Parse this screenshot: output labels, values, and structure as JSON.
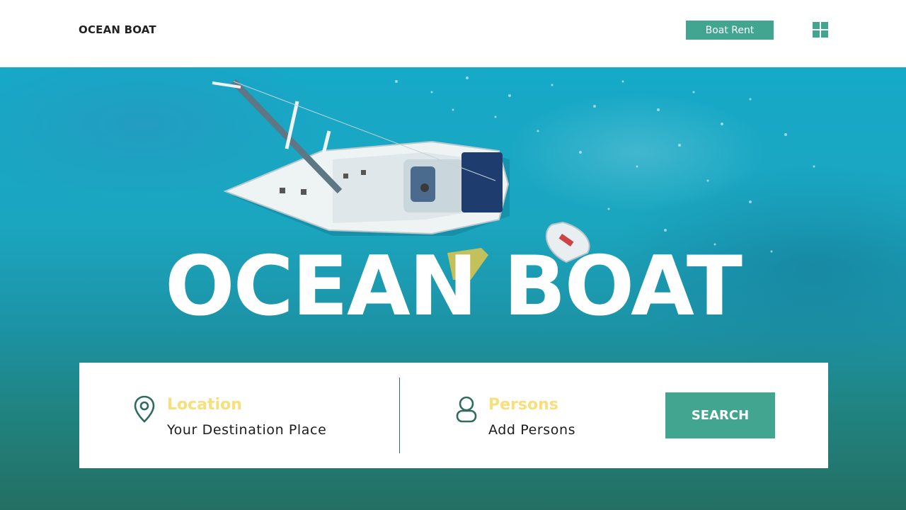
{
  "header": {
    "brand": "OCEAN BOAT",
    "rent_button": "Boat Rent",
    "menu_icon": "grid-icon"
  },
  "hero": {
    "title": "OCEAN BOAT",
    "background": "aerial photo of a sailboat and a dinghy on turquoise water"
  },
  "search": {
    "location": {
      "icon": "location-pin-icon",
      "label": "Location",
      "value": "Your Destination Place"
    },
    "persons": {
      "icon": "person-icon",
      "label": "Persons",
      "value": "Add Persons"
    },
    "button": "SEARCH"
  },
  "colors": {
    "accent": "#42a590",
    "label_yellow": "#f7df7b",
    "icon_dark_green": "#2f6b5f",
    "water_top": "#16a9c8",
    "water_bottom": "#246f63"
  }
}
